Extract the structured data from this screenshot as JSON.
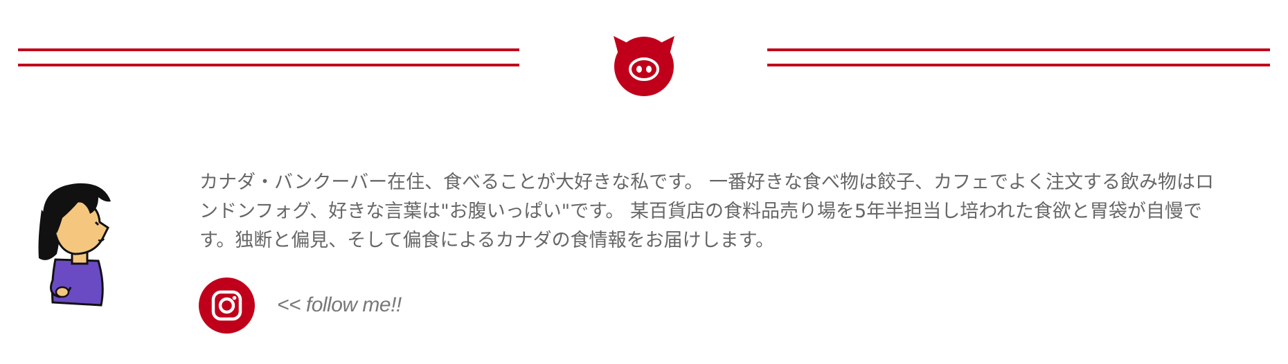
{
  "brand": {
    "accent_color": "#c0001a",
    "logo_icon": "pig-face-icon"
  },
  "profile": {
    "avatar_icon": "cartoon-girl-avatar",
    "bio": "カナダ・バンクーバー在住、食べることが大好きな私です。 一番好きな食べ物は餃子、カフェでよく注文する飲み物はロンドンフォグ、好きな言葉は\"お腹いっぱい\"です。 某百貨店の食料品売り場を5年半担当し培われた食欲と胃袋が自慢です。独断と偏見、そして偏食によるカナダの食情報をお届けします。",
    "social": {
      "icon": "instagram-icon",
      "follow_label": "<< follow me!!"
    }
  }
}
